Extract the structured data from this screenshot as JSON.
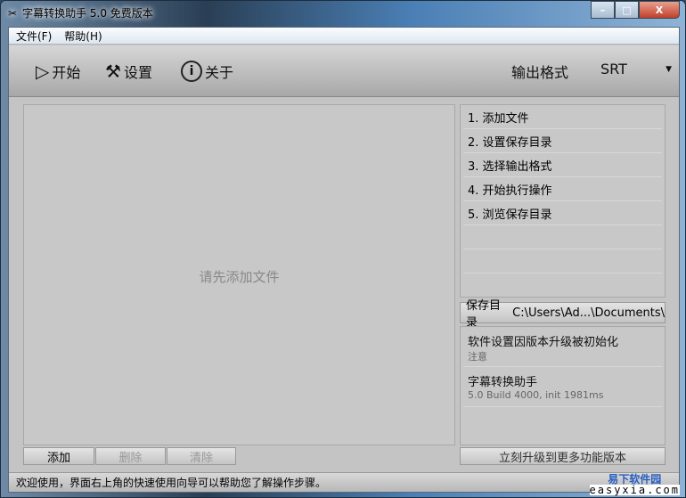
{
  "window": {
    "title": "字幕转换助手 5.0 免费版本",
    "minimize": "–",
    "maximize": "□",
    "close": "X"
  },
  "menu": [
    "文件(F)",
    "帮助(H)"
  ],
  "toolbar": {
    "start": "开始",
    "settings": "设置",
    "about": "关于",
    "format_label": "输出格式",
    "format_value": "SRT"
  },
  "file_panel": {
    "placeholder": "请先添加文件"
  },
  "steps": [
    "1. 添加文件",
    "2. 设置保存目录",
    "3. 选择输出格式",
    "4. 开始执行操作",
    "5. 浏览保存目录"
  ],
  "save_dir": {
    "label": "保存目录",
    "path": "C:\\Users\\Ad...\\Documents\\"
  },
  "info": [
    {
      "title": "软件设置因版本升级被初始化",
      "sub": "注意"
    },
    {
      "title": "字幕转换助手",
      "sub": "5.0 Build 4000, init 1981ms"
    }
  ],
  "buttons": {
    "add": "添加",
    "delete": "删除",
    "clear": "清除",
    "upgrade": "立刻升级到更多功能版本"
  },
  "status": "欢迎使用，界面右上角的快速使用向导可以帮助您了解操作步骤。",
  "watermark": {
    "cn": "易下软件园",
    "en": "easyxia.com"
  }
}
